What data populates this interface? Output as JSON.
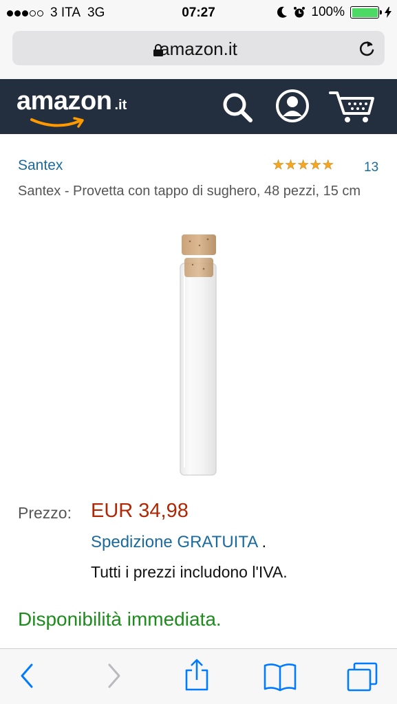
{
  "status_bar": {
    "carrier": "3 ITA",
    "network": "3G",
    "time": "07:27",
    "battery": "100%",
    "battery_level": 1.0
  },
  "browser": {
    "url": "amazon.it"
  },
  "header": {
    "logo_word": "amazon",
    "logo_tld": ".it"
  },
  "product": {
    "brand": "Santex",
    "rating_stars": 5,
    "review_count": "13",
    "title": "Santex - Provetta con tappo di sughero, 48 pezzi, 15 cm",
    "price_label": "Prezzo:",
    "price": "EUR 34,98",
    "shipping": "Spedizione GRATUITA",
    "shipping_suffix": ".",
    "vat_note": "Tutti i prezzi includono l'IVA.",
    "availability": "Disponibilità immediata."
  },
  "colors": {
    "header_bg": "#232f3e",
    "link": "#1b6a9e",
    "price": "#b12704",
    "availability": "#1d8c1d",
    "ios_blue": "#007aff",
    "star": "#f5a623"
  },
  "icons": [
    "lock-icon",
    "reload-icon",
    "search-icon",
    "account-icon",
    "cart-icon",
    "back-icon",
    "forward-icon",
    "share-icon",
    "bookmarks-icon",
    "tabs-icon"
  ]
}
